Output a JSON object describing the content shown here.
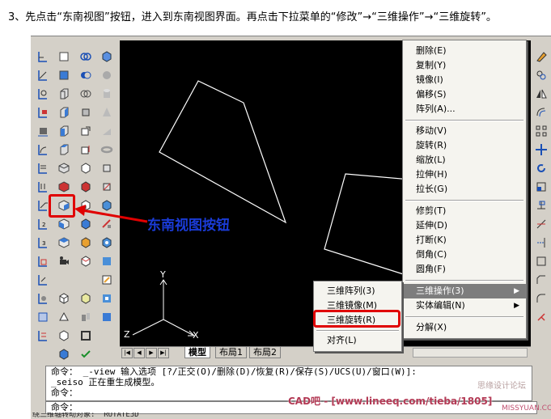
{
  "caption": "3、先点击“东南视图”按钮，进入到东南视图界面。再点击下拉菜单的“修改”→“三维操作”→“三维旋转”。",
  "annotation": "东南视图按钮",
  "context_menu": {
    "items": [
      {
        "label": "删除(E)"
      },
      {
        "label": "复制(Y)"
      },
      {
        "label": "镜像(I)"
      },
      {
        "label": "偏移(S)"
      },
      {
        "label": "阵列(A)..."
      },
      {
        "label": "移动(V)"
      },
      {
        "label": "旋转(R)"
      },
      {
        "label": "缩放(L)"
      },
      {
        "label": "拉伸(H)"
      },
      {
        "label": "拉长(G)"
      },
      {
        "label": "修剪(T)"
      },
      {
        "label": "延伸(D)"
      },
      {
        "label": "打断(K)"
      },
      {
        "label": "倒角(C)"
      },
      {
        "label": "圆角(F)"
      },
      {
        "label": "三维操作(3)",
        "highlighted": true,
        "has_submenu": true
      },
      {
        "label": "实体编辑(N)",
        "has_submenu": true
      },
      {
        "label": "分解(X)"
      }
    ]
  },
  "submenu": {
    "items": [
      {
        "label": "三维阵列(3)"
      },
      {
        "label": "三维镜像(M)"
      },
      {
        "label": "三维旋转(R)",
        "highlighted_box": true
      },
      {
        "label": "对齐(L)"
      }
    ]
  },
  "layout_tabs": {
    "tabs": [
      "模型",
      "布局1",
      "布局2"
    ],
    "active": "模型"
  },
  "ucs_axes": {
    "x": "X",
    "y": "Y",
    "z": "Z"
  },
  "command_window": {
    "line1": "命令： _-view 输入选项 [?/正交(O)/删除(D)/恢复(R)/保存(S)/UCS(U)/窗口(W)]:",
    "line2": "_seiso 正在重生成模型。",
    "line3": "命令：",
    "prompt": "命令："
  },
  "status_line": "绕三维轴转动对象:  ROTATE3D",
  "watermark": "CAD吧 - [www.lineeq.com/tieba/1805]",
  "watermark_small": "MISSYUAN.COM",
  "watermark_faint": "思缘设计论坛",
  "colors": {
    "annotation": "#1a3bd6",
    "highlight_box": "#e00000",
    "viewport_bg": "#000000"
  }
}
